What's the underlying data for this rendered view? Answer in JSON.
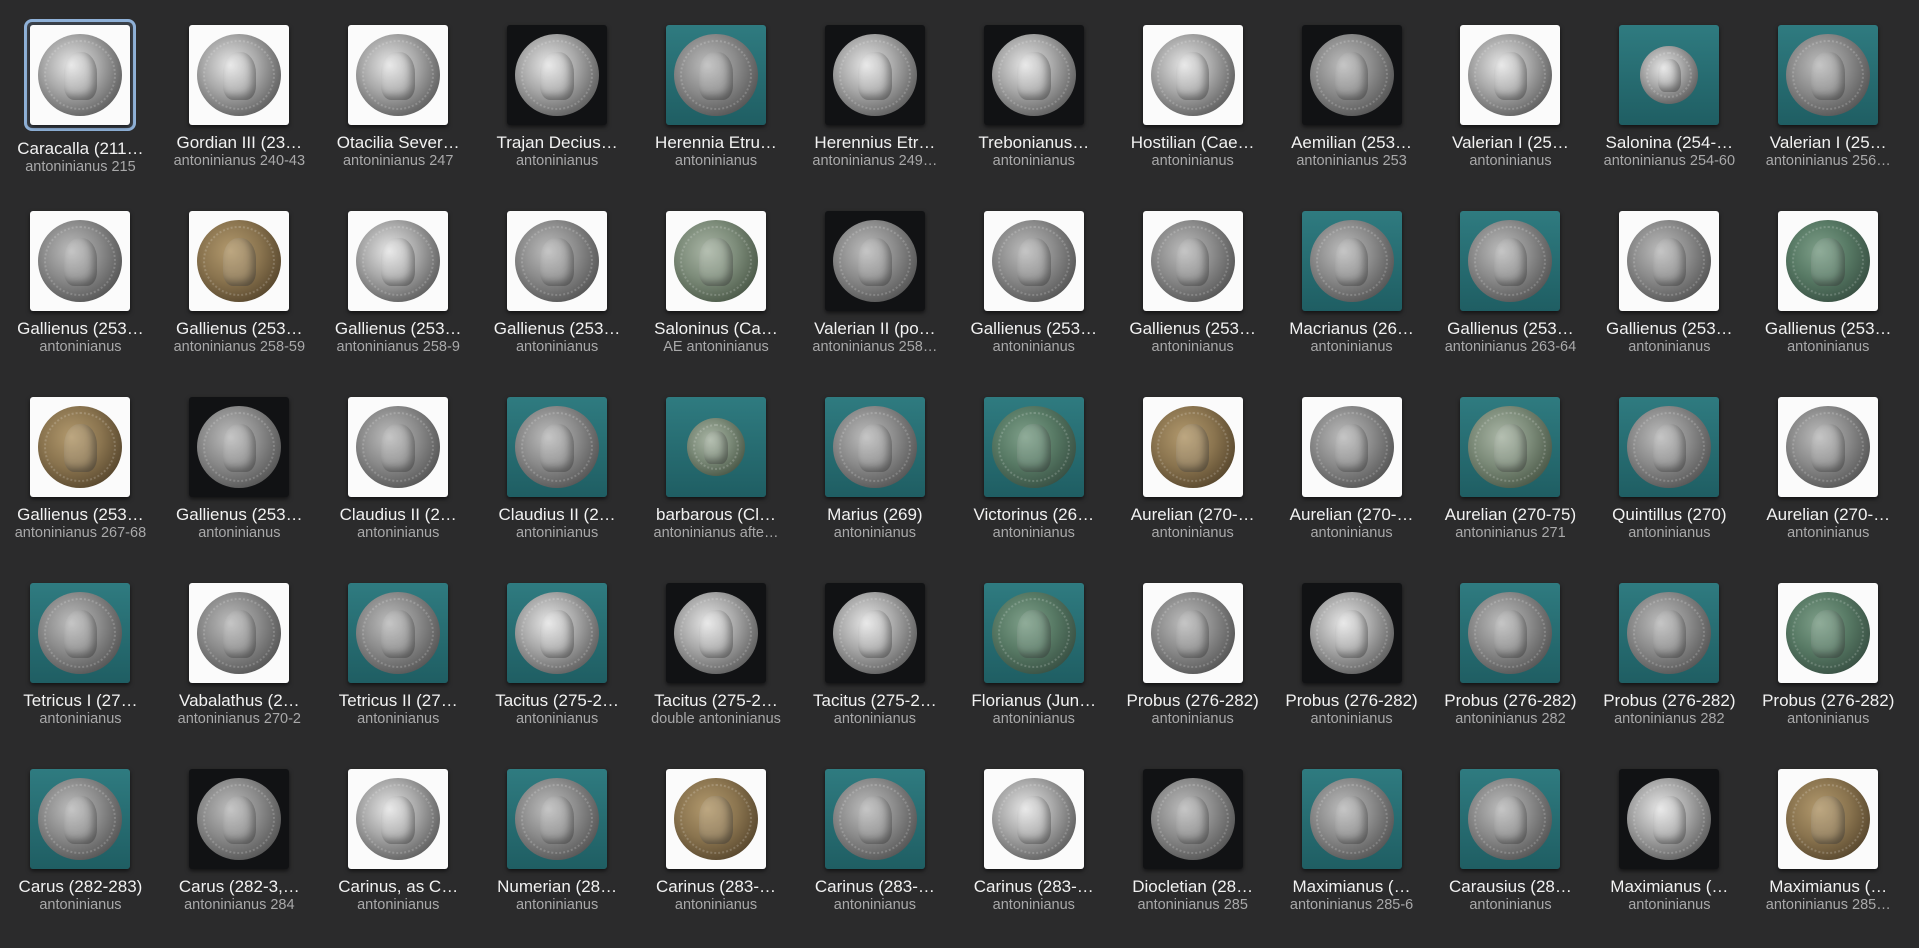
{
  "items": [
    {
      "title": "Caracalla (211…",
      "subtitle": "antoninianus 215",
      "bg": "white",
      "metal": "silver",
      "selected": true
    },
    {
      "title": "Gordian III (23…",
      "subtitle": "antoninianus 240-43",
      "bg": "white",
      "metal": "silver"
    },
    {
      "title": "Otacilia Sever…",
      "subtitle": "antoninianus 247",
      "bg": "white",
      "metal": "silver"
    },
    {
      "title": "Trajan Decius…",
      "subtitle": "antoninianus",
      "bg": "black",
      "metal": "silver"
    },
    {
      "title": "Herennia Etru…",
      "subtitle": "antoninianus",
      "bg": "teal",
      "metal": "grey"
    },
    {
      "title": "Herennius Etr…",
      "subtitle": "antoninianus 249…",
      "bg": "black",
      "metal": "silver"
    },
    {
      "title": "Trebonianus…",
      "subtitle": "antoninianus",
      "bg": "black",
      "metal": "silver"
    },
    {
      "title": "Hostilian (Cae…",
      "subtitle": "antoninianus",
      "bg": "white",
      "metal": "silver"
    },
    {
      "title": "Aemilian (253…",
      "subtitle": "antoninianus 253",
      "bg": "black",
      "metal": "grey"
    },
    {
      "title": "Valerian I (25…",
      "subtitle": "antoninianus",
      "bg": "white",
      "metal": "silver"
    },
    {
      "title": "Salonina (254-…",
      "subtitle": "antoninianus 254-60",
      "bg": "teal",
      "metal": "silver",
      "small": true
    },
    {
      "title": "Valerian I (25…",
      "subtitle": "antoninianus 256…",
      "bg": "teal",
      "metal": "grey"
    },
    {
      "title": "Gallienus (253…",
      "subtitle": "antoninianus",
      "bg": "white",
      "metal": "grey"
    },
    {
      "title": "Gallienus (253…",
      "subtitle": "antoninianus 258-59",
      "bg": "white",
      "metal": "bronze"
    },
    {
      "title": "Gallienus (253…",
      "subtitle": "antoninianus 258-9",
      "bg": "white",
      "metal": "silver"
    },
    {
      "title": "Gallienus (253…",
      "subtitle": "antoninianus",
      "bg": "white",
      "metal": "grey"
    },
    {
      "title": "Saloninus (Ca…",
      "subtitle": "AE antoninianus",
      "bg": "white",
      "metal": "green"
    },
    {
      "title": "Valerian II (po…",
      "subtitle": "antoninianus 258…",
      "bg": "black",
      "metal": "grey"
    },
    {
      "title": "Gallienus (253…",
      "subtitle": "antoninianus",
      "bg": "white",
      "metal": "grey"
    },
    {
      "title": "Gallienus (253…",
      "subtitle": "antoninianus",
      "bg": "white",
      "metal": "grey"
    },
    {
      "title": "Macrianus (26…",
      "subtitle": "antoninianus",
      "bg": "teal",
      "metal": "grey"
    },
    {
      "title": "Gallienus (253…",
      "subtitle": "antoninianus 263-64",
      "bg": "teal",
      "metal": "grey"
    },
    {
      "title": "Gallienus (253…",
      "subtitle": "antoninianus",
      "bg": "white",
      "metal": "grey"
    },
    {
      "title": "Gallienus (253…",
      "subtitle": "antoninianus",
      "bg": "white",
      "metal": "patina"
    },
    {
      "title": "Gallienus (253…",
      "subtitle": "antoninianus 267-68",
      "bg": "white",
      "metal": "bronze"
    },
    {
      "title": "Gallienus (253…",
      "subtitle": "antoninianus",
      "bg": "black",
      "metal": "grey"
    },
    {
      "title": "Claudius II (2…",
      "subtitle": "antoninianus",
      "bg": "white",
      "metal": "grey"
    },
    {
      "title": "Claudius II (2…",
      "subtitle": "antoninianus",
      "bg": "teal",
      "metal": "grey"
    },
    {
      "title": "barbarous (Cl…",
      "subtitle": "antoninianus afte…",
      "bg": "teal",
      "metal": "green",
      "small": true
    },
    {
      "title": "Marius (269)",
      "subtitle": "antoninianus",
      "bg": "teal",
      "metal": "grey"
    },
    {
      "title": "Victorinus (26…",
      "subtitle": "antoninianus",
      "bg": "teal",
      "metal": "patina"
    },
    {
      "title": "Aurelian (270-…",
      "subtitle": "antoninianus",
      "bg": "white",
      "metal": "bronze"
    },
    {
      "title": "Aurelian (270-…",
      "subtitle": "antoninianus",
      "bg": "white",
      "metal": "grey"
    },
    {
      "title": "Aurelian (270-75)",
      "subtitle": "antoninianus 271",
      "bg": "teal",
      "metal": "green"
    },
    {
      "title": "Quintillus (270)",
      "subtitle": "antoninianus",
      "bg": "teal",
      "metal": "grey"
    },
    {
      "title": "Aurelian (270-…",
      "subtitle": "antoninianus",
      "bg": "white",
      "metal": "grey"
    },
    {
      "title": "Tetricus I (27…",
      "subtitle": "antoninianus",
      "bg": "teal",
      "metal": "grey"
    },
    {
      "title": "Vabalathus (2…",
      "subtitle": "antoninianus 270-2",
      "bg": "white",
      "metal": "grey"
    },
    {
      "title": "Tetricus II (27…",
      "subtitle": "antoninianus",
      "bg": "teal",
      "metal": "grey"
    },
    {
      "title": "Tacitus (275-2…",
      "subtitle": "antoninianus",
      "bg": "teal",
      "metal": "silver"
    },
    {
      "title": "Tacitus (275-2…",
      "subtitle": "double antoninianus",
      "bg": "black",
      "metal": "silver"
    },
    {
      "title": "Tacitus (275-2…",
      "subtitle": "antoninianus",
      "bg": "black",
      "metal": "silver"
    },
    {
      "title": "Florianus (Jun…",
      "subtitle": "antoninianus",
      "bg": "teal",
      "metal": "patina"
    },
    {
      "title": "Probus (276-282)",
      "subtitle": "antoninianus",
      "bg": "white",
      "metal": "grey"
    },
    {
      "title": "Probus (276-282)",
      "subtitle": "antoninianus",
      "bg": "black",
      "metal": "silver"
    },
    {
      "title": "Probus (276-282)",
      "subtitle": "antoninianus 282",
      "bg": "teal",
      "metal": "grey"
    },
    {
      "title": "Probus (276-282)",
      "subtitle": "antoninianus 282",
      "bg": "teal",
      "metal": "grey"
    },
    {
      "title": "Probus (276-282)",
      "subtitle": "antoninianus",
      "bg": "white",
      "metal": "patina"
    },
    {
      "title": "Carus (282-283)",
      "subtitle": "antoninianus",
      "bg": "teal",
      "metal": "grey"
    },
    {
      "title": "Carus (282-3,…",
      "subtitle": "antoninianus 284",
      "bg": "black",
      "metal": "grey"
    },
    {
      "title": "Carinus, as C…",
      "subtitle": "antoninianus",
      "bg": "white",
      "metal": "silver"
    },
    {
      "title": "Numerian (28…",
      "subtitle": "antoninianus",
      "bg": "teal",
      "metal": "grey"
    },
    {
      "title": "Carinus (283-…",
      "subtitle": "antoninianus",
      "bg": "white",
      "metal": "bronze"
    },
    {
      "title": "Carinus (283-…",
      "subtitle": "antoninianus",
      "bg": "teal",
      "metal": "grey"
    },
    {
      "title": "Carinus (283-…",
      "subtitle": "antoninianus",
      "bg": "white",
      "metal": "silver"
    },
    {
      "title": "Diocletian (28…",
      "subtitle": "antoninianus 285",
      "bg": "black",
      "metal": "grey"
    },
    {
      "title": "Maximianus (…",
      "subtitle": "antoninianus 285-6",
      "bg": "teal",
      "metal": "grey"
    },
    {
      "title": "Carausius (28…",
      "subtitle": "antoninianus",
      "bg": "teal",
      "metal": "grey"
    },
    {
      "title": "Maximianus (…",
      "subtitle": "antoninianus",
      "bg": "black",
      "metal": "silver"
    },
    {
      "title": "Maximianus (…",
      "subtitle": "antoninianus 285…",
      "bg": "white",
      "metal": "bronze"
    }
  ]
}
